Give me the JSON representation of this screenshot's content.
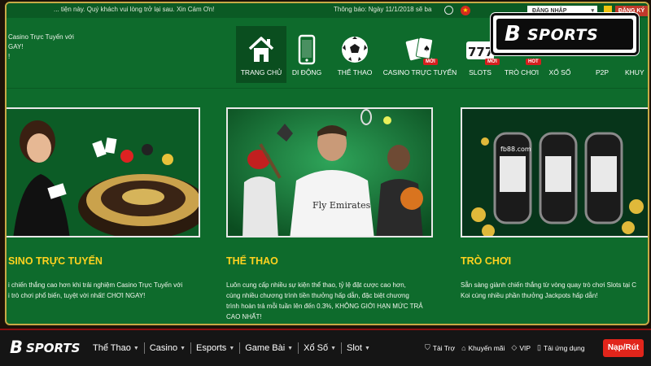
{
  "topbar": {
    "marquee": "... tiện này. Quý khách vui lòng trở lại sau. Xin Cám Ơn!",
    "notice": "Thông báo: Ngày 11/1/2018 sẽ ba",
    "login_label": "ĐĂNG NHẬP",
    "register_label": "ĐĂNG KÝ"
  },
  "left_partial": [
    "Casino Trực Tuyến với",
    "GAY!",
    "!"
  ],
  "nav": {
    "items": [
      {
        "label": "TRANG CHỦ",
        "icon": "home-icon",
        "active": true,
        "badge": ""
      },
      {
        "label": "DI ĐỘNG",
        "icon": "mobile-icon",
        "active": false,
        "badge": ""
      },
      {
        "label": "THỂ THAO",
        "icon": "soccer-ball-icon",
        "active": false,
        "badge": ""
      },
      {
        "label": "CASINO TRỰC TUYẾN",
        "icon": "cards-icon",
        "active": false,
        "badge": "MỚI"
      },
      {
        "label": "SLOTS",
        "icon": "slot-777-icon",
        "active": false,
        "badge": "MỚI"
      },
      {
        "label": "TRÒ CHƠI",
        "icon": "games-icon",
        "active": false,
        "badge": "HOT"
      },
      {
        "label": "XỔ SỐ",
        "icon": "lottery-icon",
        "active": false,
        "badge": ""
      },
      {
        "label": "P2P",
        "icon": "p2p-icon",
        "active": false,
        "badge": ""
      },
      {
        "label": "KHUY",
        "icon": "promo-icon",
        "active": false,
        "badge": ""
      }
    ],
    "slot_text": "777"
  },
  "cards": [
    {
      "title": "SINO TRỰC TUYẾN",
      "desc": [
        "i chiến thắng cao hơn khi trải nghiệm Casino Trực Tuyến với",
        "i trò chơi phổ biến, tuyệt vời nhất! CHƠI NGAY!"
      ]
    },
    {
      "title": "THỂ THAO",
      "desc": [
        "Luôn cung cấp nhiều sự kiện thể thao, tỷ lệ đặt cược cao hơn,",
        "cùng nhiều chương trình tiền thưởng hấp dẫn, đặc biệt chương",
        "trình hoàn trả mỗi tuần lên đến 0.3%, KHÔNG GIỚI HẠN MỨC TRẢ",
        "CAO NHẤT!"
      ],
      "jersey_text": "Fly Emirates"
    },
    {
      "title": "TRÒ CHƠI",
      "desc": [
        "Sẵn sàng giành chiến thắng từ vòng quay trò chơi Slots tại C",
        "Koi cùng nhiều phần thưởng Jackpots hấp dẫn!"
      ],
      "machine_label": "fb88.com"
    }
  ],
  "overlay_logo": {
    "brand": "SPORTS",
    "mark": "B"
  },
  "bottom": {
    "brand": "SPORTS",
    "nav": [
      {
        "label": "Thể Thao"
      },
      {
        "label": "Casino"
      },
      {
        "label": "Esports"
      },
      {
        "label": "Game Bài"
      },
      {
        "label": "Xổ Số"
      },
      {
        "label": "Slot"
      }
    ],
    "links": [
      {
        "label": "Tài Trợ",
        "icon": "shield-icon"
      },
      {
        "label": "Khuyến mãi",
        "icon": "tag-icon"
      },
      {
        "label": "VIP",
        "icon": "diamond-icon"
      },
      {
        "label": "Tải ứng dụng",
        "icon": "phone-icon"
      }
    ],
    "cta": "Nạp/Rút"
  },
  "colors": {
    "bg_green": "#0e6b2c",
    "title_yellow": "#ffd21f",
    "cta_red": "#e1251b",
    "frame_gold": "#c8aa46"
  }
}
